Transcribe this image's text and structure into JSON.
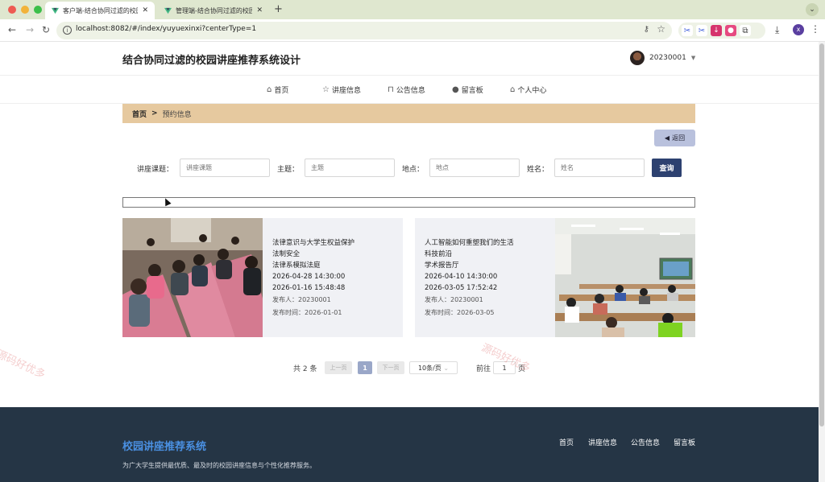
{
  "browser": {
    "tabs": [
      {
        "title": "客户端-结合协同过滤的校园讲座...",
        "active": true
      },
      {
        "title": "管理端-结合协同过滤的校园讲座...",
        "active": false
      }
    ],
    "url": "localhost:8082/#/index/yuyuexinxi?centerType=1",
    "profile_initial": "x"
  },
  "header": {
    "site_title": "结合协同过滤的校园讲座推荐系统设计",
    "username": "20230001"
  },
  "nav": {
    "items": [
      {
        "label": "首页",
        "icon": "home-icon"
      },
      {
        "label": "讲座信息",
        "icon": "star-icon"
      },
      {
        "label": "公告信息",
        "icon": "bag-icon"
      },
      {
        "label": "留言板",
        "icon": "info-icon"
      },
      {
        "label": "个人中心",
        "icon": "house-icon"
      }
    ]
  },
  "breadcrumb": {
    "home": "首页",
    "sep": ">",
    "current": "预约信息"
  },
  "back_label": "返回",
  "search": {
    "fields": [
      {
        "label": "讲座课题：",
        "placeholder": "讲座课题"
      },
      {
        "label": "主题：",
        "placeholder": "主题"
      },
      {
        "label": "地点：",
        "placeholder": "地点"
      },
      {
        "label": "姓名：",
        "placeholder": "姓名"
      }
    ],
    "button": "查询"
  },
  "cards": [
    {
      "title": "法律意识与大学生权益保护",
      "topic": "法制安全",
      "place": "法律系模拟法庭",
      "time": "2026-04-28 14:30:00",
      "booked": "2026-01-16 15:48:48",
      "publisher": "发布人：20230001",
      "pubtime": "发布时间：2026-01-01"
    },
    {
      "title": "人工智能如何重塑我们的生活",
      "topic": "科技前沿",
      "place": "学术报告厅",
      "time": "2026-04-10 14:30:00",
      "booked": "2026-03-05 17:52:42",
      "publisher": "发布人：20230001",
      "pubtime": "发布时间：2026-03-05"
    }
  ],
  "pager": {
    "total": "共 2 条",
    "prev": "上一页",
    "page": "1",
    "next": "下一页",
    "size": "10条/页",
    "goto": "前往",
    "goto_value": "1",
    "unit": "页"
  },
  "footer": {
    "title": "校园讲座推荐系统",
    "desc": "为广大学生提供最优质、最及时的校园讲座信息与个性化推荐服务。",
    "links": [
      "首页",
      "讲座信息",
      "公告信息",
      "留言板"
    ]
  },
  "watermark": "源码好优多"
}
